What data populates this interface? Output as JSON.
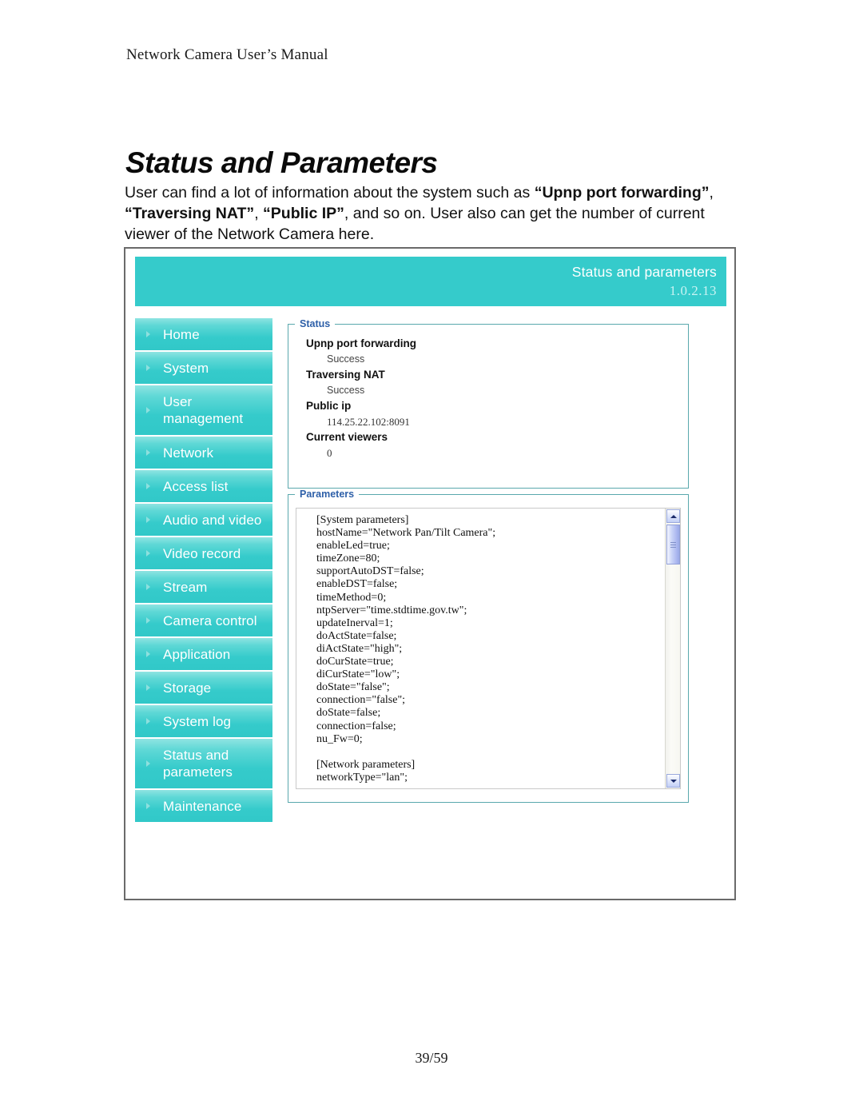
{
  "document": {
    "running_header": "Network Camera User’s Manual",
    "title": "Status and Parameters",
    "body_html": "User can find a lot of information about the system such as <b>“Upnp port forwarding”</b>, <b>“Traversing NAT”</b>, <b>“Public IP”</b>, and so on. User also can get the number of current viewer of the Network Camera here.",
    "page_number": "39/59"
  },
  "app": {
    "header": {
      "title": "Status and parameters",
      "version": "1.0.2.13",
      "background_color": "#35cbcb"
    },
    "sidebar": {
      "items": [
        {
          "label": "Home",
          "lines": 1
        },
        {
          "label": "System",
          "lines": 1
        },
        {
          "label": "User management",
          "lines": 2
        },
        {
          "label": "Network",
          "lines": 1
        },
        {
          "label": "Access list",
          "lines": 1
        },
        {
          "label": "Audio and video",
          "lines": 1
        },
        {
          "label": "Video record",
          "lines": 1
        },
        {
          "label": "Stream",
          "lines": 1
        },
        {
          "label": "Camera control",
          "lines": 1
        },
        {
          "label": "Application",
          "lines": 1
        },
        {
          "label": "Storage",
          "lines": 1
        },
        {
          "label": "System log",
          "lines": 1
        },
        {
          "label": "Status and parameters",
          "lines": 2
        },
        {
          "label": "Maintenance",
          "lines": 1
        }
      ]
    },
    "status_panel": {
      "legend": "Status",
      "entries": [
        {
          "key": "Upnp port forwarding",
          "value": "Success",
          "style": "sans"
        },
        {
          "key": "Traversing NAT",
          "value": "Success",
          "style": "sans"
        },
        {
          "key": "Public ip",
          "value": "114.25.22.102:8091",
          "style": "serif"
        },
        {
          "key": "Current viewers",
          "value": "0",
          "style": "serif"
        }
      ]
    },
    "parameters_panel": {
      "legend": "Parameters",
      "text": "[System parameters]\nhostName=\"Network Pan/Tilt Camera\";\nenableLed=true;\ntimeZone=80;\nsupportAutoDST=false;\nenableDST=false;\ntimeMethod=0;\nntpServer=\"time.stdtime.gov.tw\";\nupdateInerval=1;\ndoActState=false;\ndiActState=\"high\";\ndoCurState=true;\ndiCurState=\"low\";\ndoState=\"false\";\nconnection=\"false\";\ndoState=false;\nconnection=false;\nnu_Fw=0;\n\n[Network parameters]\nnetworkType=\"lan\";"
    }
  }
}
